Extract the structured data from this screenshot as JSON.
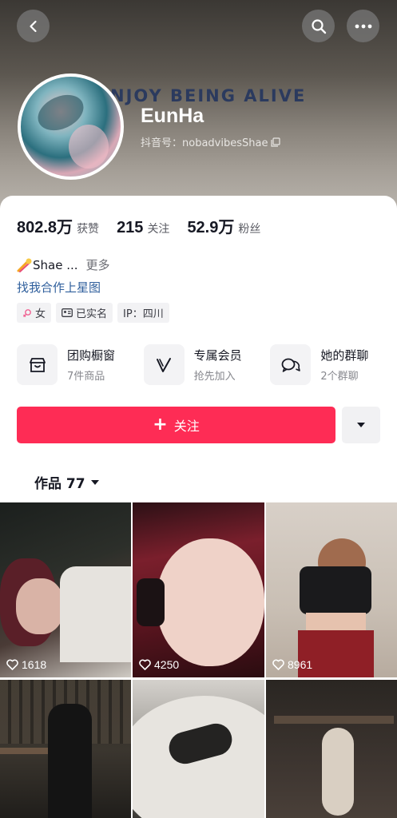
{
  "header": {
    "cover_text": "NJOY BEING ALIVE",
    "display_name": "EunHa",
    "douyin_id_label": "抖音号：nobadvibesShae"
  },
  "stats": [
    {
      "value": "802.8万",
      "label": "获赞"
    },
    {
      "value": "215",
      "label": "关注"
    },
    {
      "value": "52.9万",
      "label": "粉丝"
    }
  ],
  "bio": {
    "text": "Shae ...",
    "more": "更多",
    "link": "找我合作上星图"
  },
  "tags": [
    {
      "icon": "female-icon",
      "label": "女"
    },
    {
      "icon": "id-card-icon",
      "label": "已实名"
    },
    {
      "icon": "",
      "label": "IP：四川"
    }
  ],
  "features": [
    {
      "icon": "shop-icon",
      "title": "团购橱窗",
      "sub": "7件商品"
    },
    {
      "icon": "v-membership-icon",
      "title": "专属会员",
      "sub": "抢先加入"
    },
    {
      "icon": "chat-group-icon",
      "title": "她的群聊",
      "sub": "2个群聊"
    }
  ],
  "follow_button": "关注",
  "works_tab": "作品 77",
  "videos": [
    {
      "likes": "1618"
    },
    {
      "likes": "4250"
    },
    {
      "likes": "8961"
    },
    {
      "likes": ""
    },
    {
      "likes": ""
    },
    {
      "likes": ""
    }
  ],
  "colors": {
    "accent": "#fe2c55",
    "link": "#2f5f9c"
  }
}
